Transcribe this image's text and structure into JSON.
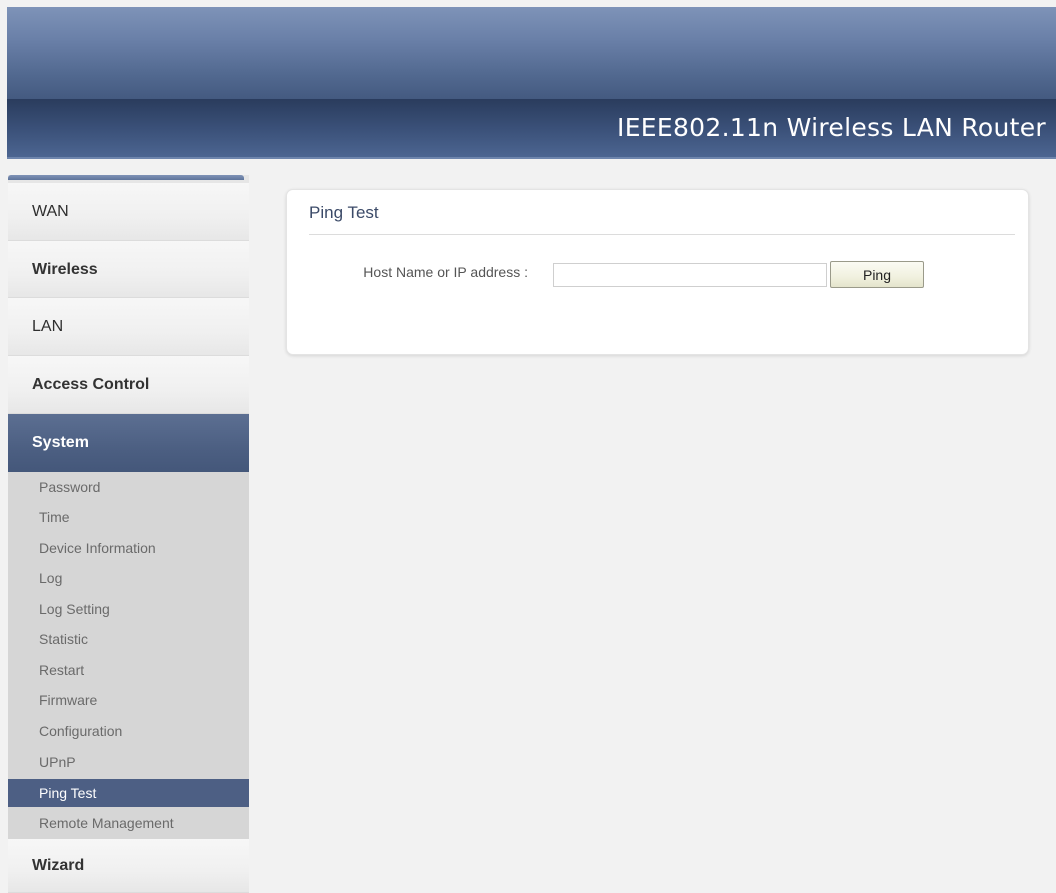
{
  "header": {
    "title": "IEEE802.11n  Wireless LAN Router"
  },
  "sidebar": {
    "items": [
      {
        "label": "WAN"
      },
      {
        "label": "Wireless"
      },
      {
        "label": "LAN"
      },
      {
        "label": "Access Control"
      },
      {
        "label": "System"
      },
      {
        "label": "Wizard"
      }
    ],
    "system_submenu": [
      {
        "label": "Password"
      },
      {
        "label": "Time"
      },
      {
        "label": "Device Information"
      },
      {
        "label": "Log"
      },
      {
        "label": "Log Setting"
      },
      {
        "label": "Statistic"
      },
      {
        "label": "Restart"
      },
      {
        "label": "Firmware"
      },
      {
        "label": "Configuration"
      },
      {
        "label": "UPnP"
      },
      {
        "label": "Ping Test"
      },
      {
        "label": "Remote Management"
      }
    ],
    "active_item": "System",
    "active_subitem": "Ping Test"
  },
  "panel": {
    "title": "Ping Test",
    "host_label": "Host Name or IP address :",
    "host_value": "",
    "host_placeholder": "",
    "ping_label": "Ping"
  },
  "colors": {
    "header_band": "#445a80",
    "nav_active": "#4d5f84",
    "panel_title": "#3b4a68"
  }
}
